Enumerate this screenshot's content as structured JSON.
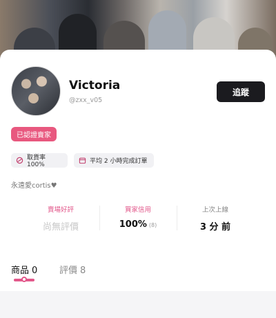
{
  "profile": {
    "name": "Victoria",
    "handle": "@zxx_v05",
    "follow_label": "追蹤",
    "verified_badge": "已認證賣家",
    "bio": "永遠愛cortis♥"
  },
  "chips": [
    {
      "icon": "delivery-icon",
      "text": "取貨率 100%"
    },
    {
      "icon": "calendar-icon",
      "text": "平均 2 小時完成訂單"
    }
  ],
  "stats": [
    {
      "label": "賣場好評",
      "value": "尚無評價"
    },
    {
      "label": "買家信用",
      "value": "100%",
      "sub": "(8)"
    },
    {
      "label": "上次上線",
      "value": "3 分 前"
    }
  ],
  "tabs": [
    {
      "label": "商品",
      "count": "0"
    },
    {
      "label": "評價",
      "count": "8"
    }
  ],
  "colors": {
    "accent": "#e2578a",
    "badge": "#e8587f",
    "button": "#1b1b1f"
  }
}
